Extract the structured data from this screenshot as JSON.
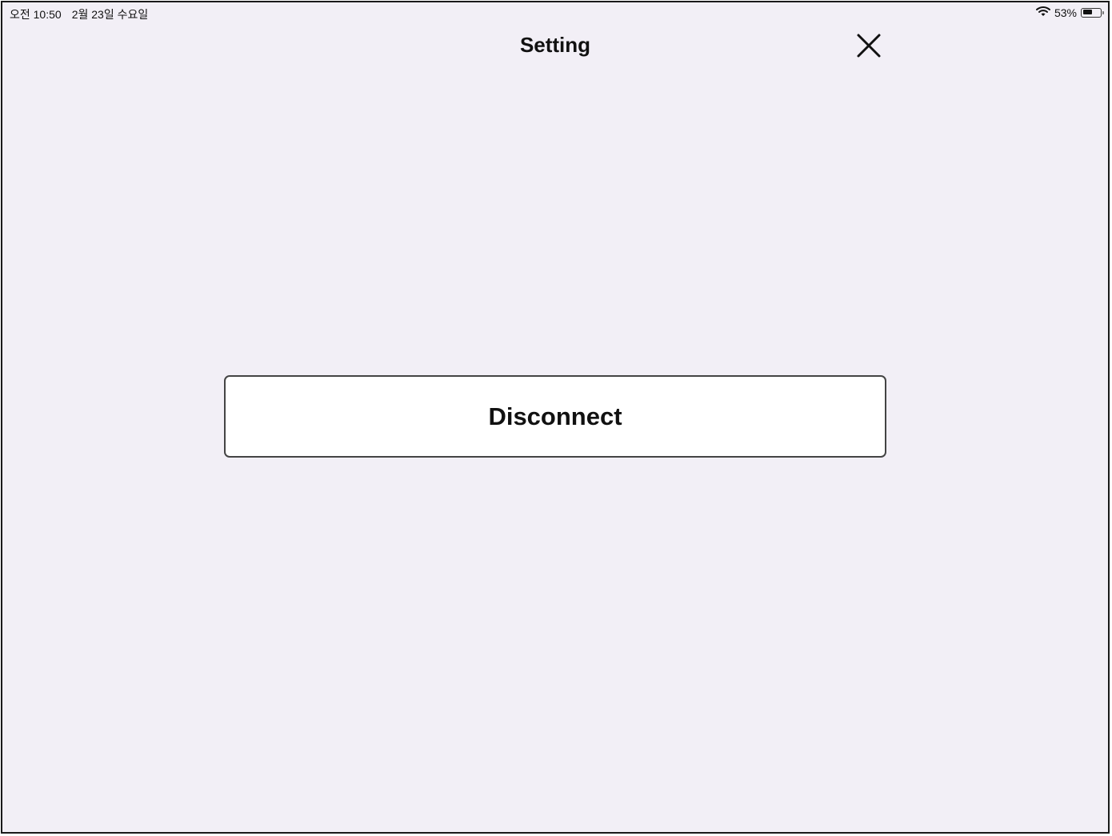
{
  "status_bar": {
    "time": "오전 10:50",
    "date": "2월 23일 수요일",
    "battery_percent_text": "53%",
    "battery_level": 0.53,
    "wifi_icon": "wifi-icon",
    "battery_icon": "battery-icon"
  },
  "header": {
    "title": "Setting",
    "close_icon": "close-icon"
  },
  "main": {
    "disconnect_label": "Disconnect"
  },
  "colors": {
    "background": "#f2eff6",
    "button_background": "#ffffff",
    "button_border": "#444444",
    "text": "#111111"
  }
}
